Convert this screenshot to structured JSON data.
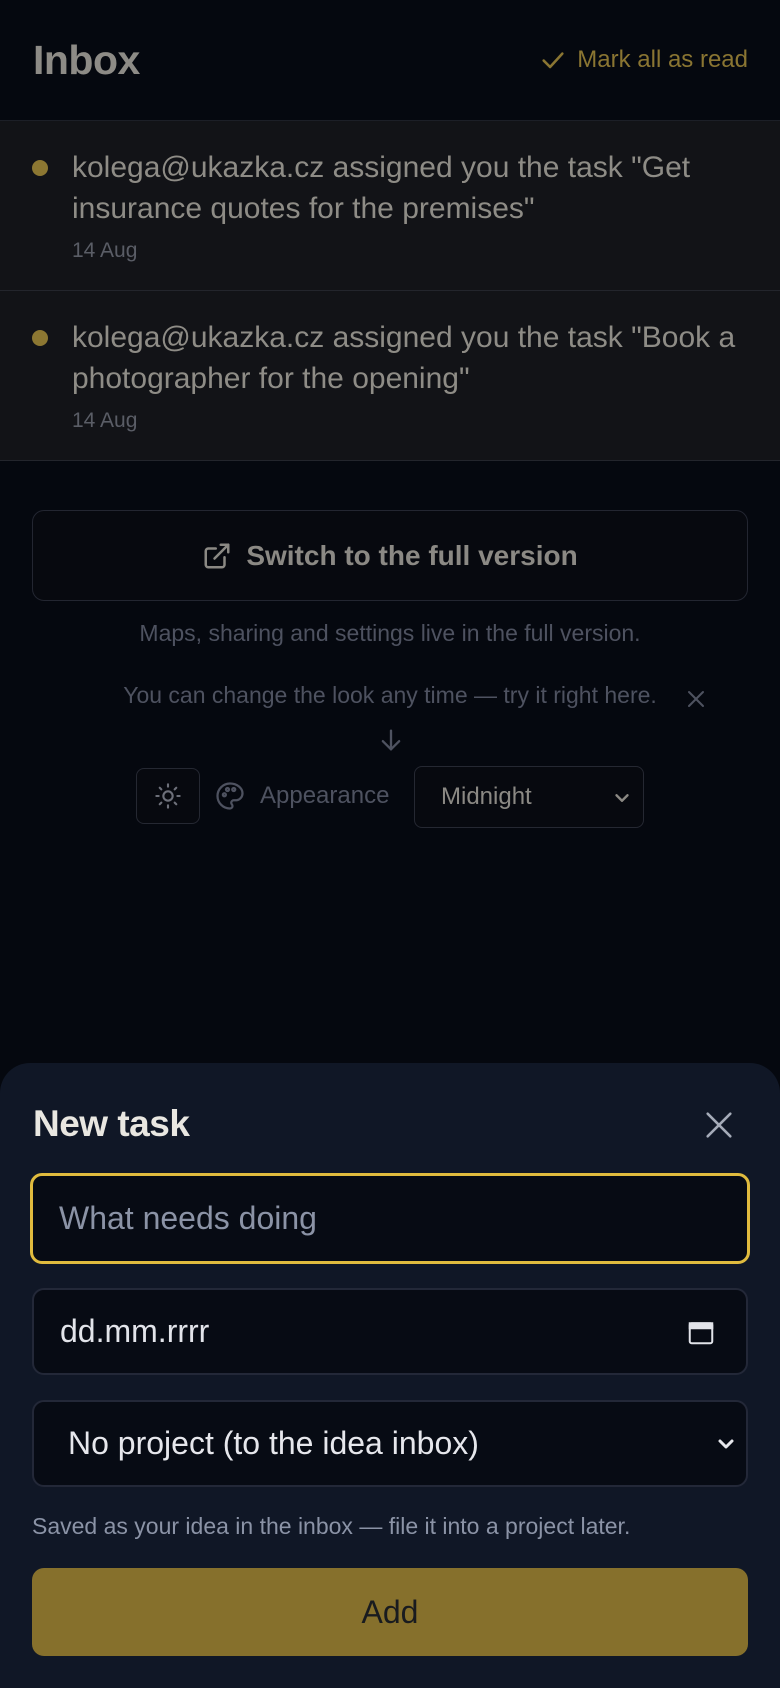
{
  "header": {
    "title": "Inbox",
    "mark_all_label": "Mark all as read"
  },
  "notifications": [
    {
      "text": "kolega@ukazka.cz assigned you the task \"Get insurance quotes for the premises\"",
      "date": "14 Aug",
      "unread": true
    },
    {
      "text": "kolega@ukazka.cz assigned you the task \"Book a photographer for the opening\"",
      "date": "14 Aug",
      "unread": true
    }
  ],
  "full_version": {
    "button_label": "Switch to the full version",
    "note": "Maps, sharing and settings live in the full version."
  },
  "appearance_hint": {
    "text": "You can change the look any time — try it right here."
  },
  "appearance": {
    "label": "Appearance",
    "selected": "Midnight"
  },
  "new_task": {
    "title": "New task",
    "task_placeholder": "What needs doing",
    "date_placeholder": "dd.mm.rrrr",
    "project_selected": "No project (to the idea inbox)",
    "saved_note": "Saved as your idea in the inbox — file it into a project later.",
    "add_label": "Add"
  },
  "colors": {
    "accent": "#e0bb3e",
    "accent_dim": "#86702c",
    "unread_dot": "#8c7732",
    "background": "#05080f",
    "sheet_background": "#101726"
  }
}
